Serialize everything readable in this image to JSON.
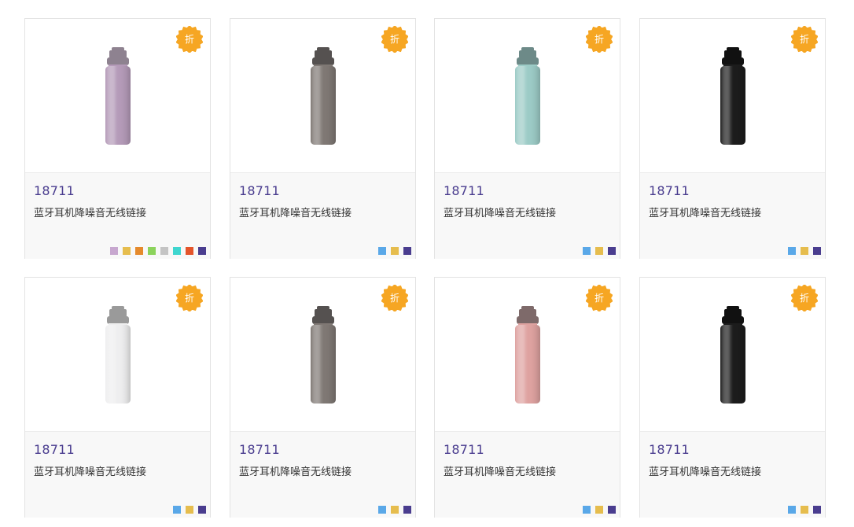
{
  "badge_label": "折",
  "products": [
    {
      "code": "18711",
      "title": "蓝牙耳机降噪音无线链接",
      "bottle_color": "#b49ab8",
      "cap_color": "#8e8290",
      "swatches": [
        "#c7a7cf",
        "#e6bd4e",
        "#e58a2c",
        "#8cd35c",
        "#c4c4c4",
        "#3fd6cf",
        "#e4542a",
        "#4a3d8f"
      ]
    },
    {
      "code": "18711",
      "title": "蓝牙耳机降噪音无线链接",
      "bottle_color": "#7f7874",
      "cap_color": "#555150",
      "swatches": [
        "#5aa8e8",
        "#e6bd4e",
        "#4a3d8f"
      ]
    },
    {
      "code": "18711",
      "title": "蓝牙耳机降噪音无线链接",
      "bottle_color": "#9ccbc6",
      "cap_color": "#6d8a88",
      "swatches": [
        "#5aa8e8",
        "#e6bd4e",
        "#4a3d8f"
      ]
    },
    {
      "code": "18711",
      "title": "蓝牙耳机降噪音无线链接",
      "bottle_color": "#1c1c1c",
      "cap_color": "#111111",
      "swatches": [
        "#5aa8e8",
        "#e6bd4e",
        "#4a3d8f"
      ]
    },
    {
      "code": "18711",
      "title": "蓝牙耳机降噪音无线链接",
      "bottle_color": "#eeeeef",
      "cap_color": "#9a9a9a",
      "swatches": [
        "#5aa8e8",
        "#e6bd4e",
        "#4a3d8f"
      ]
    },
    {
      "code": "18711",
      "title": "蓝牙耳机降噪音无线链接",
      "bottle_color": "#7f7874",
      "cap_color": "#555150",
      "swatches": [
        "#5aa8e8",
        "#e6bd4e",
        "#4a3d8f"
      ]
    },
    {
      "code": "18711",
      "title": "蓝牙耳机降噪音无线链接",
      "bottle_color": "#dea2a0",
      "cap_color": "#7e6a6a",
      "swatches": [
        "#5aa8e8",
        "#e6bd4e",
        "#4a3d8f"
      ]
    },
    {
      "code": "18711",
      "title": "蓝牙耳机降噪音无线链接",
      "bottle_color": "#1c1c1c",
      "cap_color": "#111111",
      "swatches": [
        "#5aa8e8",
        "#e6bd4e",
        "#4a3d8f"
      ]
    }
  ],
  "badge_color": "#f6a623"
}
